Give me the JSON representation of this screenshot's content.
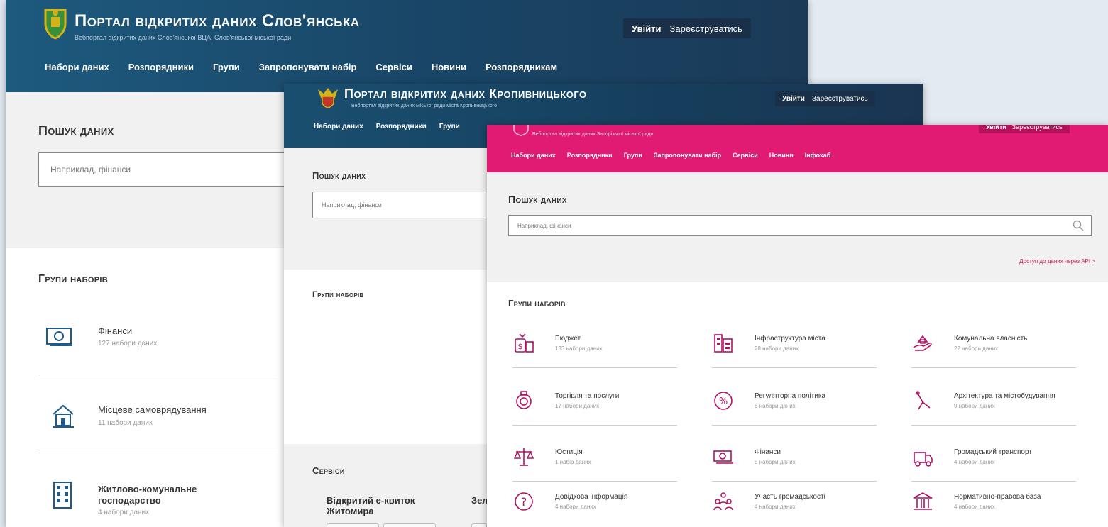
{
  "slov": {
    "title": "Портал відкритих даних Слов'янська",
    "subtitle": "Вебпортал відкритих даних Слов'янської ВЦА, Слов'янської міської ради",
    "login": "Увійти",
    "register": "Зареєструватись",
    "nav": [
      "Набори даних",
      "Розпорядники",
      "Групи",
      "Запропонувати набір",
      "Сервіси",
      "Новини",
      "Розпорядникам"
    ],
    "search_title": "Пошук даних",
    "search_placeholder": "Наприклад, фінанси",
    "groups_title": "Групи наборів",
    "groups": [
      {
        "name": "Фінанси",
        "count": "127 набори даних",
        "icon": "money-icon"
      },
      {
        "name": "Місцеве самоврядування",
        "count": "11 набори даних",
        "icon": "building-icon"
      },
      {
        "name": "Житлово-комунальне господарство",
        "count": "4 набори даних",
        "icon": "apartment-icon"
      }
    ]
  },
  "krop": {
    "title": "Портал відкритих даних Кропивницького",
    "subtitle": "Вебпортал відкритих даних Міської ради міста Кропивницького",
    "login": "Увійти",
    "register": "Зареєструватись",
    "nav": [
      "Набори даних",
      "Розпорядники",
      "Групи"
    ],
    "search_title": "Пошук даних",
    "search_placeholder": "Наприклад, фінанси",
    "groups_title": "Групи наборів",
    "services_title": "Сервіси",
    "service_1": "Відкритий е-квиток Житомира",
    "service_2": "Зел"
  },
  "zap": {
    "subtitle": "Вебпортал відкритих даних Запорізької міської ради",
    "login": "Увійти",
    "register": "Зареєструватись",
    "nav": [
      "Набори даних",
      "Розпорядники",
      "Групи",
      "Запропонувати набір",
      "Сервіси",
      "Новини",
      "Інфохаб"
    ],
    "search_title": "Пошук даних",
    "search_placeholder": "Наприклад, фінанси",
    "api_link": "Доступ до даних через API >",
    "groups_title": "Групи наборів",
    "groups": [
      {
        "name": "Бюджет",
        "count": "133 набори даних",
        "icon": "budget-icon"
      },
      {
        "name": "Інфраструктура міста",
        "count": "28 набори даних",
        "icon": "city-infrastructure-icon"
      },
      {
        "name": "Комунальна власність",
        "count": "22 набори даних",
        "icon": "communal-property-icon"
      },
      {
        "name": "Торгівля та послуги",
        "count": "17 набори даних",
        "icon": "trade-icon"
      },
      {
        "name": "Регуляторна політика",
        "count": "6 набори даних",
        "icon": "percent-icon"
      },
      {
        "name": "Архітектура та містобудування",
        "count": "9 набори даних",
        "icon": "architecture-icon"
      },
      {
        "name": "Юстиція",
        "count": "1 набір даних",
        "icon": "scales-icon"
      },
      {
        "name": "Фінанси",
        "count": "5 набори даних",
        "icon": "money-icon"
      },
      {
        "name": "Громадський транспорт",
        "count": "4 набори даних",
        "icon": "transport-icon"
      },
      {
        "name": "Довідкова інформація",
        "count": "4 набори даних",
        "icon": "question-icon"
      },
      {
        "name": "Участь громадськості",
        "count": "4 набори даних",
        "icon": "people-icon"
      },
      {
        "name": "Нормативно-правова база",
        "count": "4 набори даних",
        "icon": "law-building-icon"
      }
    ]
  },
  "colors": {
    "slov_header": "#194566",
    "krop_header": "#163e5c",
    "zap_header": "#e11b74",
    "accent_link": "#d0155f"
  }
}
